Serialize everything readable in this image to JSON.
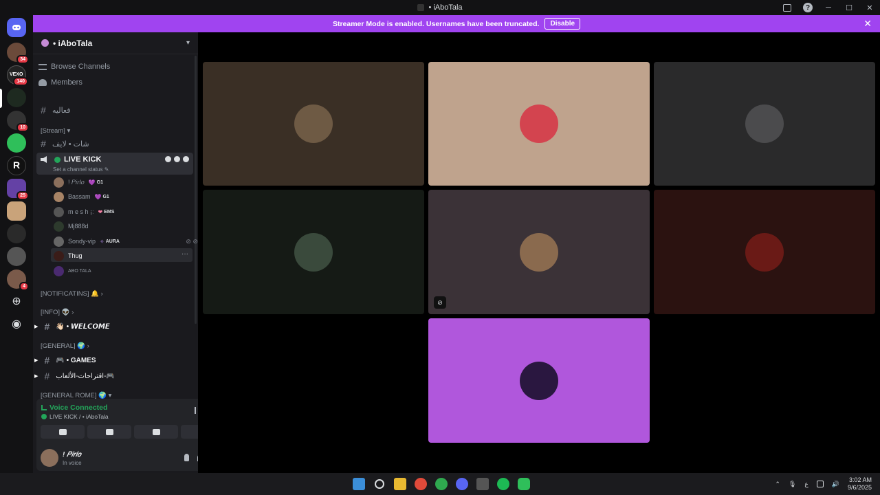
{
  "window": {
    "title": "• iAboTala"
  },
  "banner": {
    "message": "Streamer Mode is enabled. Usernames have been truncated.",
    "button": "Disable",
    "color": "#a044f0"
  },
  "rail": {
    "badges": [
      "34",
      "140",
      "10",
      "25",
      "4"
    ],
    "server_label": "VEXO"
  },
  "server": {
    "name": "• iAboTala"
  },
  "nav": {
    "browse": "Browse Channels",
    "members": "Members"
  },
  "channels": {
    "top": "فعاليه",
    "stream_cat": "[Stream]",
    "stream_chat": "شات • لايف",
    "voice": {
      "name": "LIVE KICK",
      "status": "Set a channel status"
    },
    "notifications_cat": "[NOTIFICATINS] 🔔",
    "info_cat": "[INFO] 👽",
    "welcome": "👋🏻 • 𝙒𝙀𝙇𝘾𝙊𝙈𝙀",
    "general_cat": "[GENERAL] 🌍",
    "games": "🎮 • GAMES",
    "suggestions": "اقتراحات-الألعاب-🎮",
    "general_rome_cat": "[GENERAL ROME] 🌍"
  },
  "members": [
    {
      "name": "! 𝑃𝑖𝑟𝑙𝑜",
      "tag": "G1",
      "heart": "💜"
    },
    {
      "name": "Bassam",
      "tag": "G1",
      "heart": "💜"
    },
    {
      "name": "m e s h ¡ː",
      "tag": "EMS",
      "heart": "❤"
    },
    {
      "name": "Mj888d",
      "tag": "",
      "heart": ""
    },
    {
      "name": "Sondy-vip",
      "tag": "AURA",
      "heart": "✧"
    },
    {
      "name": "Thug",
      "tag": "",
      "heart": ""
    },
    {
      "name": "ABO TALA",
      "tag": "",
      "heart": ""
    }
  ],
  "panel": {
    "voice_title": "Voice Connected",
    "voice_sub": "LIVE KICK / • iAboTala",
    "user_name": "! 𝑃𝑖𝑟𝑙𝑜",
    "user_status": "In voice"
  },
  "tiles": [
    {
      "bg": "#3a2f25",
      "pfp": "#6e5a44"
    },
    {
      "bg": "#bfa38d",
      "pfp": "#d3444f"
    },
    {
      "bg": "#2a2a2b",
      "pfp": "#4b4b4d"
    },
    {
      "bg": "#151a15",
      "pfp": "#3a4a3c"
    },
    {
      "bg": "#3b3237",
      "pfp": "#8a6a4e"
    },
    {
      "bg": "#2b1210",
      "pfp": "#6a1a16"
    },
    {
      "bg": "#b057dc",
      "pfp": "#2a1740"
    }
  ],
  "taskbar": {
    "time": "3:02 AM",
    "date": "9/6/2025",
    "lang": "ع"
  }
}
